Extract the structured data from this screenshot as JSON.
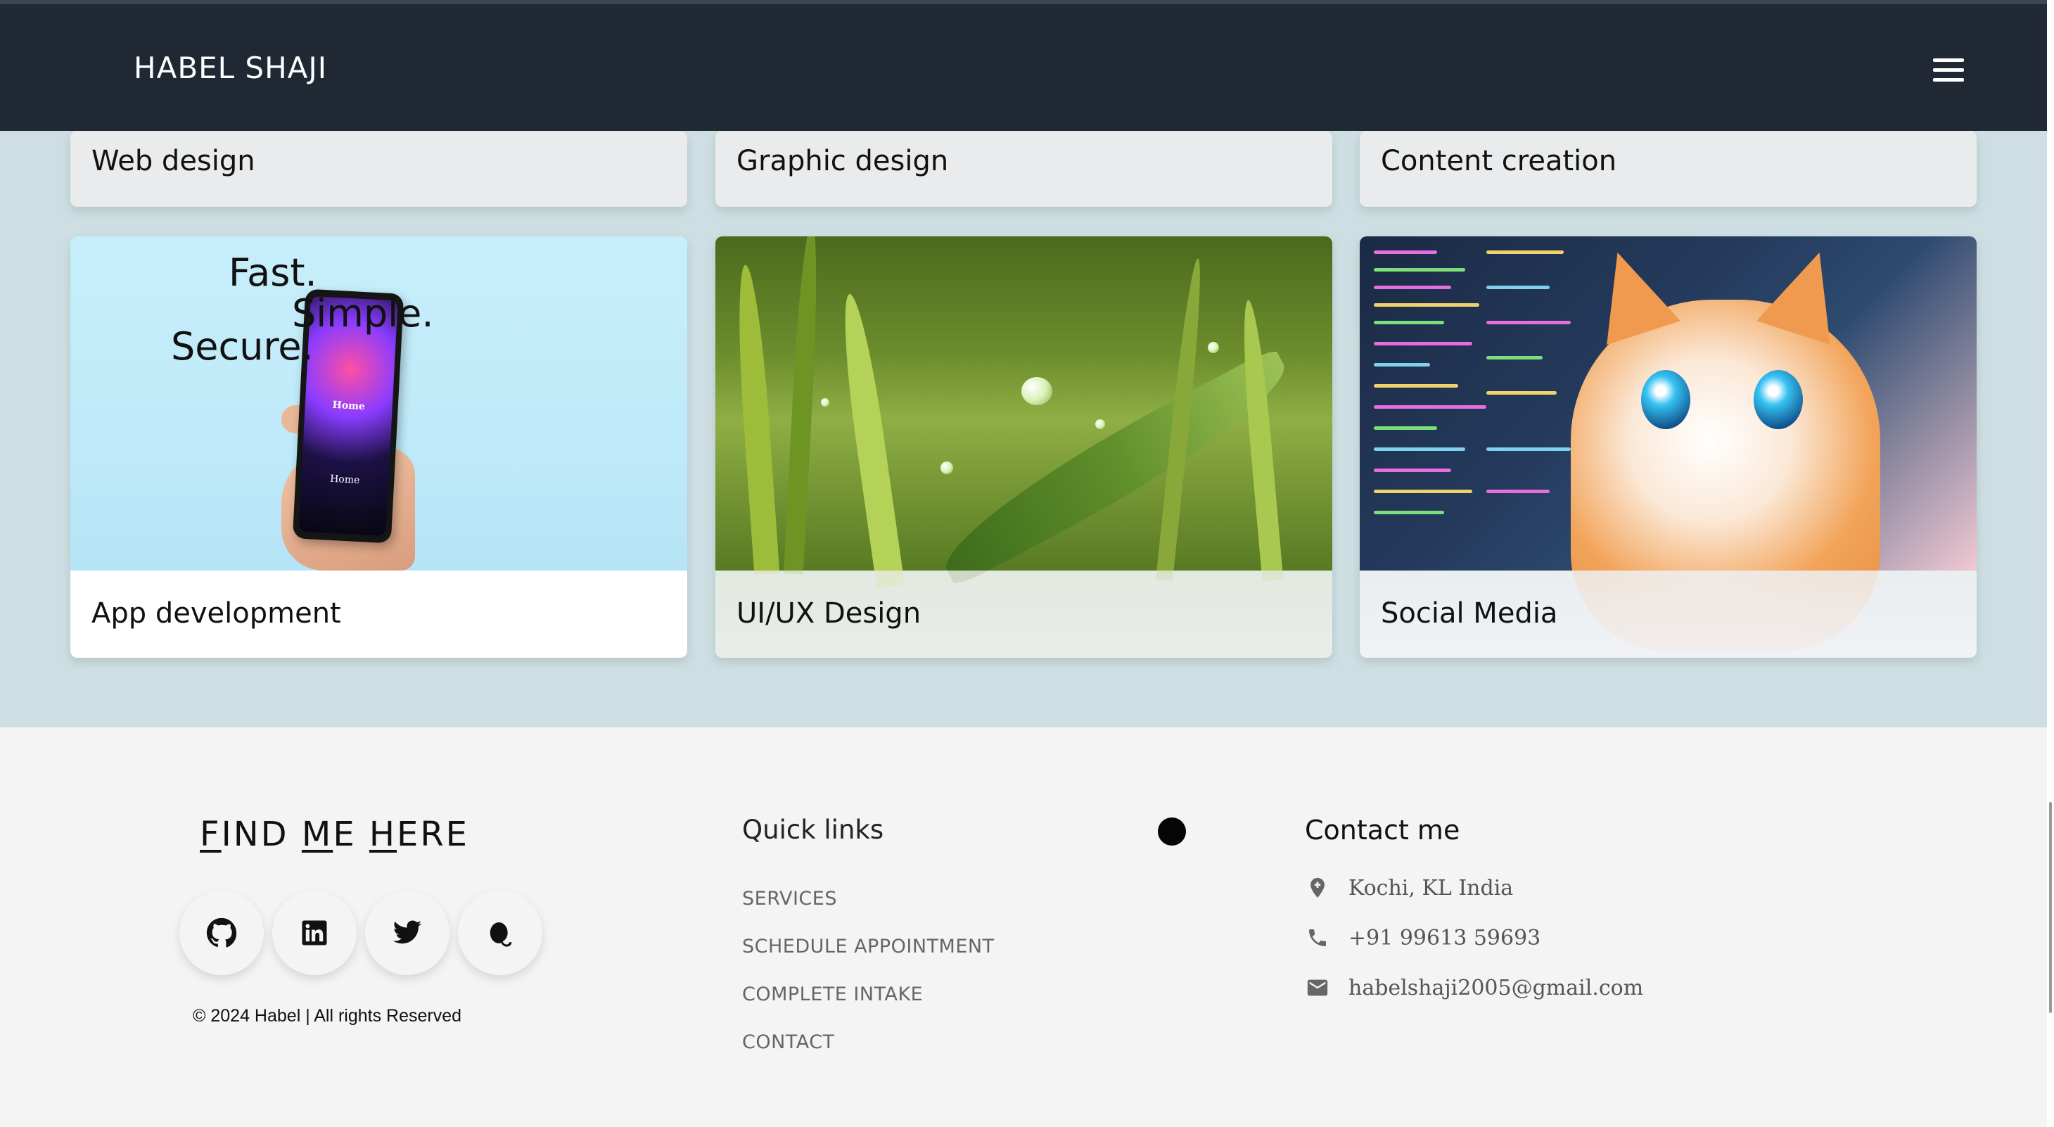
{
  "navbar": {
    "brand": "HABEL SHAJI",
    "menu_icon": "hamburger-menu-icon"
  },
  "services": {
    "row1": [
      {
        "label": "Web design"
      },
      {
        "label": "Graphic design"
      },
      {
        "label": "Content creation"
      }
    ],
    "row2": [
      {
        "label": "App development",
        "image_text": {
          "line1": "Fast.",
          "line2": "Simple.",
          "line3": "Secure.",
          "phone_title": "Home",
          "phone_sub": "Home"
        }
      },
      {
        "label": "UI/UX Design"
      },
      {
        "label": "Social Media"
      }
    ]
  },
  "footer": {
    "find_me": {
      "title_parts": [
        "F",
        "IND ",
        "M",
        "E ",
        "H",
        "ERE"
      ],
      "social_icons": [
        "github-icon",
        "linkedin-icon",
        "twitter-icon",
        "quora-icon"
      ],
      "copyright": "© 2024 Habel | All rights Reserved"
    },
    "quick_links": {
      "title": "Quick links",
      "links": [
        "SERVICES",
        "SCHEDULE APPOINTMENT",
        "COMPLETE INTAKE",
        "CONTACT"
      ]
    },
    "contact": {
      "title": "Contact me",
      "location": "Kochi, KL India",
      "phone": "+91 99613 59693",
      "email": "habelshaji2005@gmail.com"
    }
  },
  "colors": {
    "navbar_bg": "#1f2833",
    "services_bg": "#cddfe2",
    "footer_bg": "#f4f4f4"
  }
}
